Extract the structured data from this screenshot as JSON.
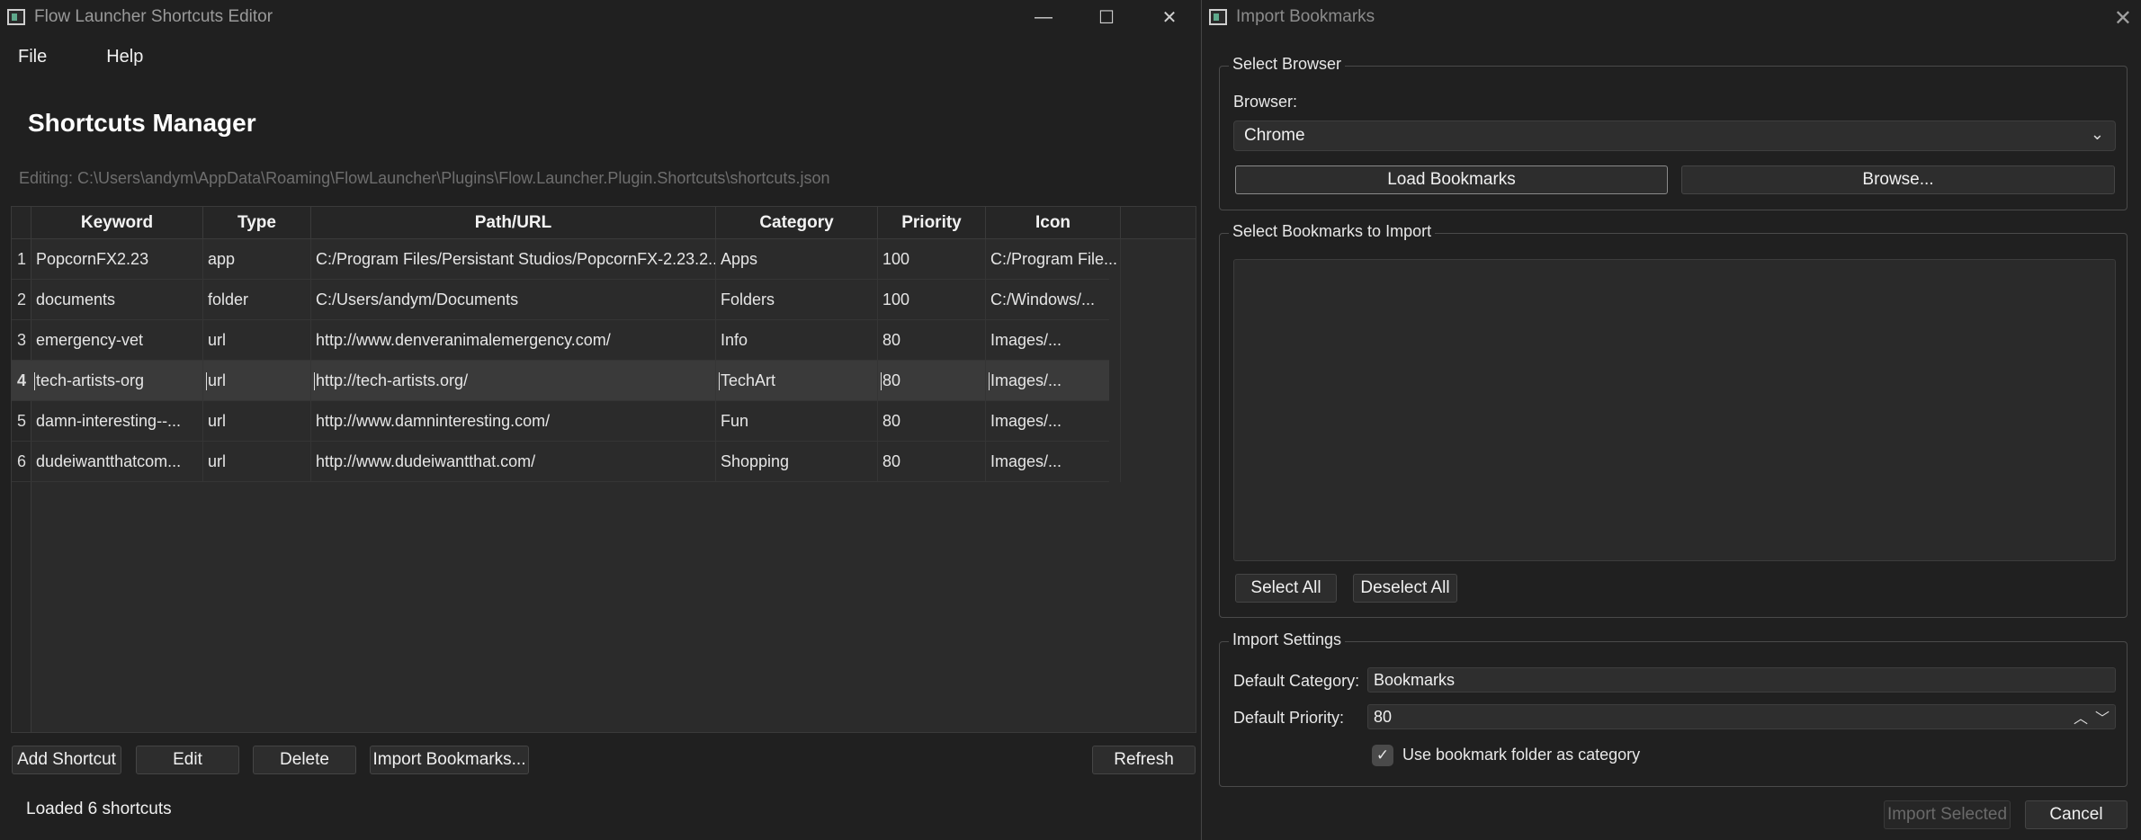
{
  "main_window": {
    "title": "Flow Launcher Shortcuts Editor",
    "menu": [
      "File",
      "Help"
    ],
    "page_title": "Shortcuts Manager",
    "editing_path": "Editing: C:\\Users\\andym\\AppData\\Roaming\\FlowLauncher\\Plugins\\Flow.Launcher.Plugin.Shortcuts\\shortcuts.json",
    "table": {
      "columns": [
        "Keyword",
        "Type",
        "Path/URL",
        "Category",
        "Priority",
        "Icon"
      ],
      "rows": [
        {
          "n": "1",
          "keyword": "PopcornFX2.23",
          "type": "app",
          "path": "C:/Program Files/Persistant Studios/PopcornFX-2.23.2...",
          "category": "Apps",
          "priority": "100",
          "icon": "C:/Program File..."
        },
        {
          "n": "2",
          "keyword": "documents",
          "type": "folder",
          "path": "C:/Users/andym/Documents",
          "category": "Folders",
          "priority": "100",
          "icon": "C:/Windows/..."
        },
        {
          "n": "3",
          "keyword": "emergency-vet",
          "type": "url",
          "path": "http://www.denveranimalemergency.com/",
          "category": "Info",
          "priority": "80",
          "icon": "Images/..."
        },
        {
          "n": "4",
          "keyword": "tech-artists-org",
          "type": "url",
          "path": "http://tech-artists.org/",
          "category": "TechArt",
          "priority": "80",
          "icon": "Images/..."
        },
        {
          "n": "5",
          "keyword": "damn-interesting--...",
          "type": "url",
          "path": "http://www.damninteresting.com/",
          "category": "Fun",
          "priority": "80",
          "icon": "Images/..."
        },
        {
          "n": "6",
          "keyword": "dudeiwantthatcom...",
          "type": "url",
          "path": "http://www.dudeiwantthat.com/",
          "category": "Shopping",
          "priority": "80",
          "icon": "Images/..."
        }
      ]
    },
    "buttons": {
      "add": "Add Shortcut",
      "edit": "Edit",
      "delete": "Delete",
      "import": "Import Bookmarks...",
      "refresh": "Refresh"
    },
    "status": "Loaded 6 shortcuts"
  },
  "import_dialog": {
    "title": "Import Bookmarks",
    "select_browser": {
      "group_title": "Select Browser",
      "browser_label": "Browser:",
      "browser_value": "Chrome",
      "load_button": "Load Bookmarks",
      "browse_button": "Browse..."
    },
    "select_bookmarks": {
      "group_title": "Select Bookmarks to Import",
      "select_all": "Select All",
      "deselect_all": "Deselect All"
    },
    "import_settings": {
      "group_title": "Import Settings",
      "default_category_label": "Default Category:",
      "default_category_value": "Bookmarks",
      "default_priority_label": "Default Priority:",
      "default_priority_value": "80",
      "use_folder_label": "Use bookmark folder as category",
      "use_folder_checked": true
    },
    "import_selected": "Import Selected",
    "cancel": "Cancel"
  }
}
